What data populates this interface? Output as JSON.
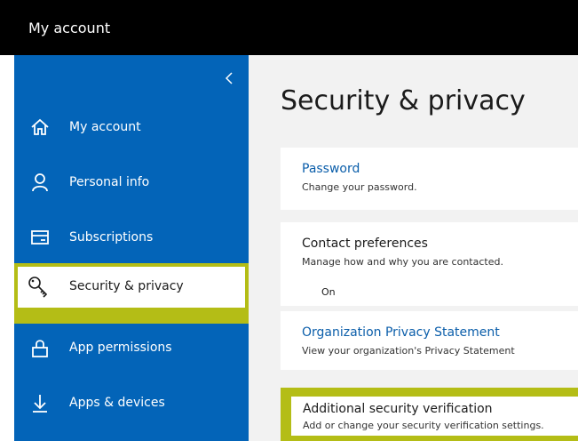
{
  "topbar": {
    "title": "My account"
  },
  "sidebar": {
    "items": [
      {
        "label": "My account",
        "icon": "home-icon"
      },
      {
        "label": "Personal info",
        "icon": "person-icon"
      },
      {
        "label": "Subscriptions",
        "icon": "card-icon"
      },
      {
        "label": "Security & privacy",
        "icon": "key-icon",
        "active": true
      },
      {
        "label": "App permissions",
        "icon": "lock-icon"
      },
      {
        "label": "Apps & devices",
        "icon": "download-icon"
      }
    ]
  },
  "main": {
    "title": "Security & privacy",
    "cards": [
      {
        "title": "Password",
        "subtitle": "Change your password."
      },
      {
        "title": "Contact preferences",
        "subtitle": "Manage how and why you are contacted.",
        "value": "On"
      },
      {
        "title": "Organization Privacy Statement",
        "subtitle": "View your organization's Privacy Statement"
      },
      {
        "title": "Additional security verification",
        "subtitle": "Add or change your security verification settings."
      }
    ]
  },
  "colors": {
    "sidebar": "#0364b8",
    "highlight": "#b4bd16",
    "link": "#0b5eaa",
    "topbar": "#000000"
  }
}
